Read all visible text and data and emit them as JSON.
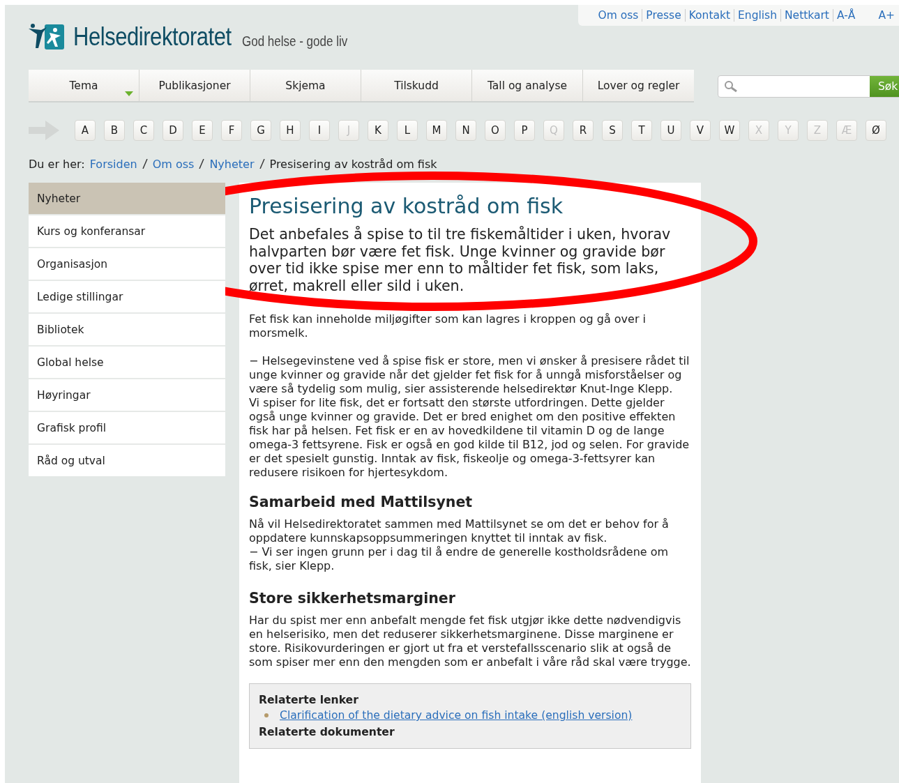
{
  "top_links": [
    "Om oss",
    "Presse",
    "Kontakt",
    "English",
    "Nettkart",
    "A-Å"
  ],
  "font_size_link": "A+",
  "logo": {
    "name": "Helsedirektoratet",
    "tagline": "God helse - gode liv"
  },
  "nav": [
    {
      "label": "Tema",
      "has_menu": true
    },
    {
      "label": "Publikasjoner",
      "has_menu": false
    },
    {
      "label": "Skjema",
      "has_menu": false
    },
    {
      "label": "Tilskudd",
      "has_menu": false
    },
    {
      "label": "Tall og analyse",
      "has_menu": false
    },
    {
      "label": "Lover og regler",
      "has_menu": false
    }
  ],
  "search": {
    "button": "Søk"
  },
  "alphabet": [
    {
      "letter": "A",
      "disabled": false
    },
    {
      "letter": "B",
      "disabled": false
    },
    {
      "letter": "C",
      "disabled": false
    },
    {
      "letter": "D",
      "disabled": false
    },
    {
      "letter": "E",
      "disabled": false
    },
    {
      "letter": "F",
      "disabled": false
    },
    {
      "letter": "G",
      "disabled": false
    },
    {
      "letter": "H",
      "disabled": false
    },
    {
      "letter": "I",
      "disabled": false
    },
    {
      "letter": "J",
      "disabled": true
    },
    {
      "letter": "K",
      "disabled": false
    },
    {
      "letter": "L",
      "disabled": false
    },
    {
      "letter": "M",
      "disabled": false
    },
    {
      "letter": "N",
      "disabled": false
    },
    {
      "letter": "O",
      "disabled": false
    },
    {
      "letter": "P",
      "disabled": false
    },
    {
      "letter": "Q",
      "disabled": true
    },
    {
      "letter": "R",
      "disabled": false
    },
    {
      "letter": "S",
      "disabled": false
    },
    {
      "letter": "T",
      "disabled": false
    },
    {
      "letter": "U",
      "disabled": false
    },
    {
      "letter": "V",
      "disabled": false
    },
    {
      "letter": "W",
      "disabled": false
    },
    {
      "letter": "X",
      "disabled": true
    },
    {
      "letter": "Y",
      "disabled": true
    },
    {
      "letter": "Z",
      "disabled": true
    },
    {
      "letter": "Æ",
      "disabled": true
    },
    {
      "letter": "Ø",
      "disabled": false
    }
  ],
  "breadcrumb": {
    "label": "Du er her:",
    "links": [
      "Forsiden",
      "Om oss",
      "Nyheter"
    ],
    "current": "Presisering av kostråd om fisk"
  },
  "sidebar": [
    {
      "label": "Nyheter",
      "selected": true
    },
    {
      "label": "Kurs og konferansar",
      "selected": false
    },
    {
      "label": "Organisasjon",
      "selected": false
    },
    {
      "label": "Ledige stillingar",
      "selected": false
    },
    {
      "label": "Bibliotek",
      "selected": false
    },
    {
      "label": "Global helse",
      "selected": false
    },
    {
      "label": "Høyringar",
      "selected": false
    },
    {
      "label": "Grafisk profil",
      "selected": false
    },
    {
      "label": "Råd og utval",
      "selected": false
    }
  ],
  "article": {
    "title": "Presisering av kostråd om fisk",
    "lead": "Det anbefales å spise to til tre fiskemåltider i uken, hvorav halvparten bør være fet fisk. Unge kvinner og gravide bør over tid ikke spise mer enn to måltider fet fisk, som laks, ørret, makrell eller sild i uken.",
    "blocks": [
      {
        "kind": "paragraph",
        "text": "Fet fisk kan inneholde miljøgifter som kan lagres i kroppen og gå over i morsmelk."
      },
      {
        "kind": "line",
        "text": "− Helsegevinstene ved å spise fisk er store, men vi ønsker å presisere rådet til unge kvinner og gravide når det gjelder fet fisk for å unngå misforståelser og være så tydelig som mulig, sier assisterende helsedirektør Knut-Inge Klepp."
      },
      {
        "kind": "paragraph",
        "text": "Vi spiser for lite fisk, det er fortsatt den største utfordringen. Dette gjelder også unge kvinner og gravide. Det er bred enighet om den positive effekten fisk har på helsen. Fet fisk er en av hovedkildene til vitamin D og de lange omega-3 fettsyrene. Fisk er også en god kilde til B12, jod og selen. For gravide er det spesielt gunstig. Inntak av fisk, fiskeolje og omega-3-fettsyrer kan redusere risikoen for hjertesykdom."
      },
      {
        "kind": "heading",
        "text": "Samarbeid med Mattilsynet"
      },
      {
        "kind": "line",
        "text": "Nå vil Helsedirektoratet sammen med Mattilsynet se om det er behov for å oppdatere kunnskapsoppsummeringen knyttet til inntak av fisk."
      },
      {
        "kind": "paragraph",
        "text": "− Vi ser ingen grunn per i dag til å endre de generelle kostholdsrådene om fisk, sier Klepp."
      },
      {
        "kind": "spacer"
      },
      {
        "kind": "heading",
        "text": "Store sikkerhetsmarginer"
      },
      {
        "kind": "paragraph",
        "text": "Har du spist mer enn anbefalt mengde fet fisk utgjør ikke dette nødvendigvis en helserisiko, men det reduserer sikkerhetsmarginene. Disse marginene er store.  Risikovurderingen er gjort ut fra et verstefallsscenario slik at også de som spiser mer enn den mengden som er anbefalt i våre råd skal være trygge."
      }
    ],
    "related": {
      "links_title": "Relaterte lenker",
      "links": [
        "Clarification of the dietary advice on fish intake (english version)"
      ],
      "documents_title": "Relaterte dokumenter"
    }
  },
  "highlight": {
    "kind": "ellipse"
  }
}
